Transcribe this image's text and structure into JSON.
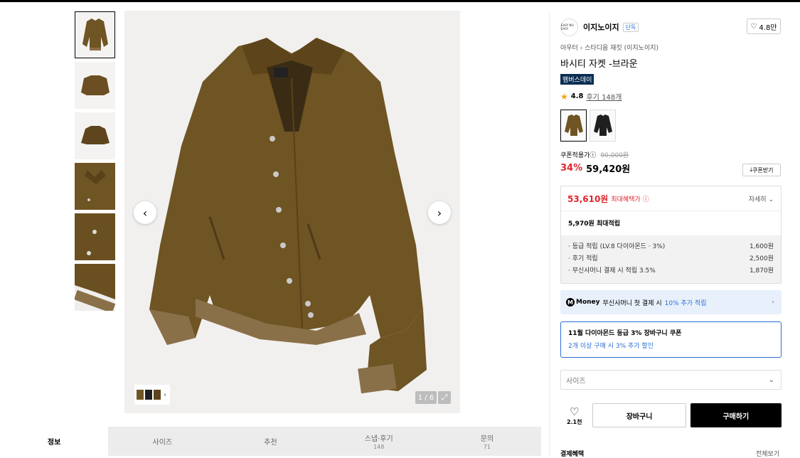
{
  "gallery": {
    "counter": "1 / 6",
    "prev_icon": "chevron-left-icon",
    "next_icon": "chevron-right-icon"
  },
  "tabs": [
    {
      "label": "정보",
      "sub": ""
    },
    {
      "label": "사이즈",
      "sub": ""
    },
    {
      "label": "추천",
      "sub": ""
    },
    {
      "label": "스냅·후기",
      "sub": "148"
    },
    {
      "label": "문의",
      "sub": "71"
    }
  ],
  "product": {
    "brand_logo_text": "EASY NO EASY",
    "brand": "이지노이지",
    "brand_tag": "단독",
    "likes": "4.8만",
    "breadcrumb": [
      "아우터",
      "스타디움 재킷 (이지노이지)"
    ],
    "title": "바시티 자켓 -브라운",
    "badge": "멤버스데이",
    "rating": "4.8",
    "reviews": "후기 148개",
    "colors": [
      {
        "name": "brown",
        "hex": "#6f5424"
      },
      {
        "name": "black",
        "hex": "#1f1f1f"
      }
    ],
    "coupon_label": "쿠폰적용가",
    "original_price": "90,000원",
    "discount": "34%",
    "price": "59,420원",
    "get_coupon": "쿠폰받기"
  },
  "benefit": {
    "max_price": "53,610원",
    "max_label": "최대혜택가",
    "detail_label": "자세히",
    "accrual": "5,970원 최대적립",
    "lines": [
      {
        "label": "· 등급 적립 (LV.8 다이아몬드 · 3%)",
        "value": "1,600원"
      },
      {
        "label": "· 후기 적립",
        "value": "2,500원"
      },
      {
        "label": "· 무신사머니 결제 시 적립 3.5%",
        "value": "1,870원"
      }
    ]
  },
  "money": {
    "logo": "Money",
    "text": "무신사머니 첫 결제 시",
    "highlight": "10% 추가 적립"
  },
  "coupon_box": {
    "title": "11월 다이아몬드 등급 3% 장바구니 쿠폰",
    "sub": "2개 이상 구매 시 3% 추가 할인"
  },
  "size_select": {
    "placeholder": "사이즈"
  },
  "actions": {
    "wish_count": "2.1천",
    "cart": "장바구니",
    "buy": "구매하기"
  },
  "payment": {
    "title": "결제혜택",
    "all": "전체보기"
  },
  "colors": {
    "accent_red": "#e0262c",
    "accent_blue": "#2a6fd6",
    "badge_navy": "#0a2d52"
  }
}
